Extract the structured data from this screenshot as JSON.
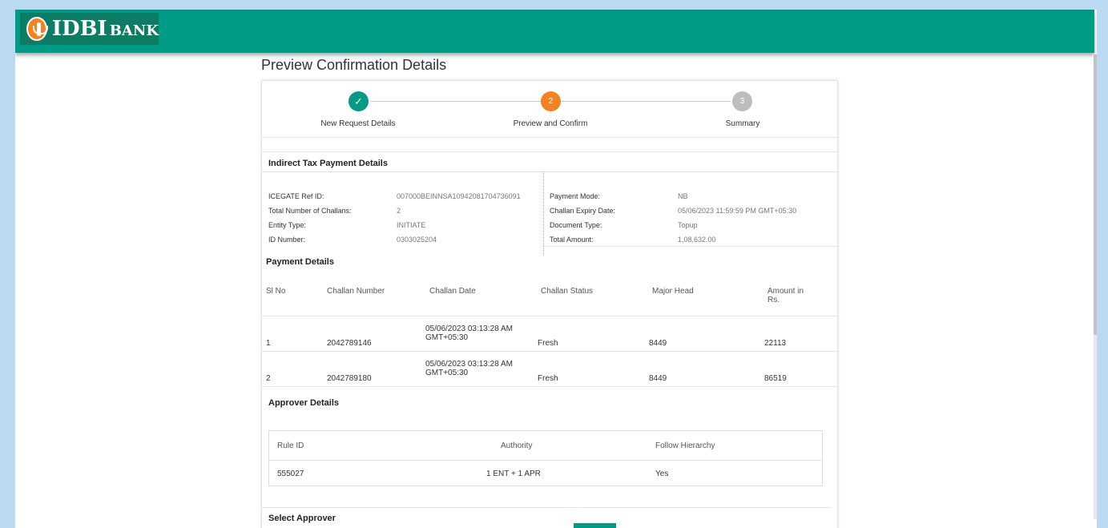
{
  "brand": {
    "logo_idbi": "IDBI",
    "logo_bank": "BANK",
    "color": "#009b84"
  },
  "page_title": "Preview Confirmation Details",
  "stepper": {
    "steps": [
      {
        "label": "New Request Details",
        "marker": "✓",
        "state": "done",
        "color": "#009b84"
      },
      {
        "label": "Preview and Confirm",
        "marker": "2",
        "state": "active",
        "color": "#f58220"
      },
      {
        "label": "Summary",
        "marker": "3",
        "state": "pending",
        "color": "#bdbdbd"
      }
    ]
  },
  "indirect_tax": {
    "title": "Indirect Tax Payment Details",
    "left": [
      {
        "label": "ICEGATE Ref ID:",
        "value": "007000BEINNSA10942081704736091"
      },
      {
        "label": "Total Number of Challans:",
        "value": "2"
      },
      {
        "label": "Entity Type:",
        "value": "INITIATE"
      },
      {
        "label": "ID Number:",
        "value": "0303025204"
      }
    ],
    "right": [
      {
        "label": "Payment Mode:",
        "value": "NB"
      },
      {
        "label": "Challan Expiry Date:",
        "value": "05/06/2023 11:59:59 PM GMT+05:30"
      },
      {
        "label": "Document Type:",
        "value": "Topup"
      },
      {
        "label": "Total Amount:",
        "value": "1,08,632.00"
      }
    ]
  },
  "payment_details": {
    "title": "Payment Details",
    "columns": [
      "Sl No",
      "Challan Number",
      "Challan Date",
      "Challan Status",
      "Major Head",
      "Amount in Rs."
    ],
    "rows": [
      [
        "1",
        "2042789146",
        "05/06/2023 03:13:28 AM GMT+05:30",
        "Fresh",
        "8449",
        "22113"
      ],
      [
        "2",
        "2042789180",
        "05/06/2023 03:13:28 AM GMT+05:30",
        "Fresh",
        "8449",
        "86519"
      ]
    ]
  },
  "approver_details": {
    "title": "Approver Details",
    "columns": [
      "Rule ID",
      "Authority",
      "Follow Hierarchy"
    ],
    "rows": [
      [
        "555027",
        "1 ENT + 1 APR",
        "Yes"
      ]
    ]
  },
  "select_approver": {
    "title": "Select Approver"
  }
}
